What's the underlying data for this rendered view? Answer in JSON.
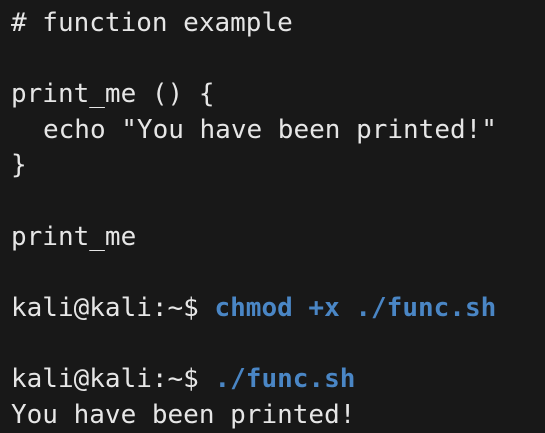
{
  "terminal": {
    "lines": {
      "comment": "# function example",
      "func_decl": "print_me () {",
      "func_body": "echo \"You have been printed!\"",
      "func_close": "}",
      "func_call": "print_me"
    },
    "commands": [
      {
        "prompt": "kali@kali:~$",
        "command": "chmod +x ./func.sh"
      },
      {
        "prompt": "kali@kali:~$",
        "command": "./func.sh"
      }
    ],
    "output": "You have been printed!"
  },
  "colors": {
    "background": "#181818",
    "text": "#e6e6e6",
    "command": "#4a86c5"
  }
}
